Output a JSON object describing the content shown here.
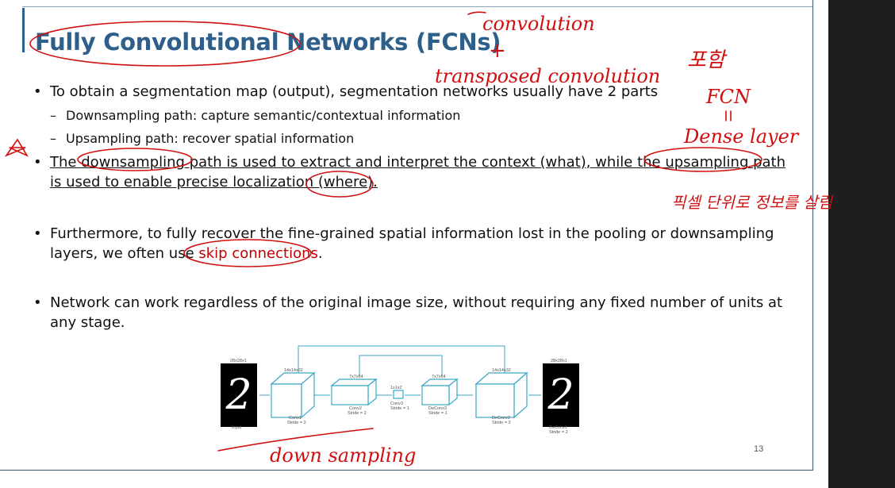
{
  "title": "Fully Convolutional Networks (FCNs)",
  "bullet_glyph": "•",
  "dash_glyph": "–",
  "bullets": [
    {
      "text": "To obtain a segmentation map (output), segmentation networks usually have 2 parts"
    },
    {
      "sub1": "Downsampling path: capture semantic/contextual information",
      "sub2": "Upsampling path: recover spatial information"
    },
    {
      "line1": "The downsampling path is used to extract and interpret the context (what), while the upsampling path",
      "line2": "is used to enable precise localization (where)."
    },
    {
      "line1": "Furthermore, to fully recover the fine-grained spatial information lost in the pooling or downsampling",
      "line2_pre": "layers, we often use ",
      "line2_red": "skip connections",
      "line2_post": "."
    },
    {
      "line1": "Network can work regardless of the original image size, without requiring any fixed number of units at",
      "line2": "any stage."
    }
  ],
  "diagram": {
    "input_size": "28x28x1",
    "input_label": "Input",
    "conv1_size": "14x14x32",
    "conv1_label": "Conv1",
    "conv1_stride": "Stride = 2",
    "conv2_size": "7x7x64",
    "conv2_label": "Conv2",
    "conv2_stride": "Stride = 2",
    "conv3_size": "1x1x2",
    "conv3_label": "Conv3",
    "conv3_stride": "Stride = 1",
    "deconv3_size": "7x7x64",
    "deconv3_label": "DeConv3",
    "deconv3_stride": "Stride = 1",
    "deconv2_size": "14x14x32",
    "deconv2_label": "DeConv2",
    "deconv2_stride": "Stride = 2",
    "output_size": "28x28x1",
    "deconv1_label": "DeConv1",
    "deconv1_stride": "Stride = 2",
    "digit": "2"
  },
  "page_number": "13",
  "handwriting": {
    "convolution": "convolution",
    "plus": "+",
    "transpose": "transposed convolution",
    "korean_top": "포함",
    "fcn": "FCN",
    "dense": "Dense layer",
    "korean_mid": "픽셀 단위로 정보를 살림",
    "down_sampling": "down sampling"
  },
  "colors": {
    "title": "#2e5f8a",
    "accent_red": "#c00000",
    "ink": "#d01010",
    "diagram_line": "#3aa6c8"
  }
}
